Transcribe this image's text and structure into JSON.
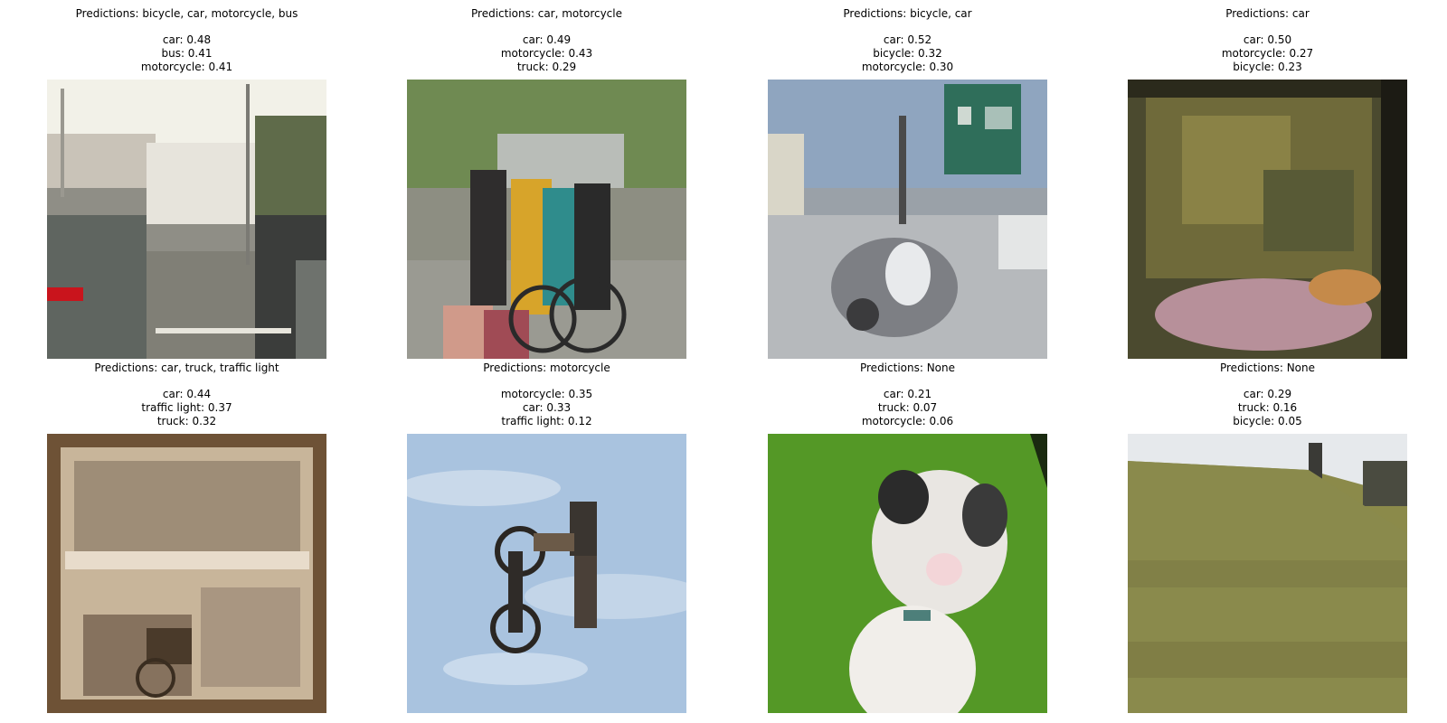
{
  "panels": [
    {
      "title": "Predictions: bicycle, car, motorcycle, bus",
      "scores": [
        "car: 0.48",
        "bus: 0.41",
        "motorcycle: 0.41"
      ],
      "scene": "street-traffic"
    },
    {
      "title": "Predictions: car, motorcycle",
      "scores": [
        "car: 0.49",
        "motorcycle: 0.43",
        "truck: 0.29"
      ],
      "scene": "people-with-bicycles"
    },
    {
      "title": "Predictions: bicycle, car",
      "scores": [
        "car: 0.52",
        "bicycle: 0.32",
        "motorcycle: 0.30"
      ],
      "scene": "street-with-sign"
    },
    {
      "title": "Predictions: car",
      "scores": [
        "car: 0.50",
        "motorcycle: 0.27",
        "bicycle: 0.23"
      ],
      "scene": "forest-flowers"
    },
    {
      "title": "Predictions: car, truck, traffic light",
      "scores": [
        "car: 0.44",
        "traffic light: 0.37",
        "truck: 0.32"
      ],
      "scene": "sepia-rider"
    },
    {
      "title": "Predictions: motorcycle",
      "scores": [
        "motorcycle: 0.35",
        "car: 0.33",
        "traffic light: 0.12"
      ],
      "scene": "sky-jump"
    },
    {
      "title": "Predictions: None",
      "scores": [
        "car: 0.21",
        "truck: 0.07",
        "motorcycle: 0.06"
      ],
      "scene": "cat-on-grass"
    },
    {
      "title": "Predictions: None",
      "scores": [
        "car: 0.29",
        "truck: 0.16",
        "bicycle: 0.05"
      ],
      "scene": "grassy-hill"
    }
  ]
}
